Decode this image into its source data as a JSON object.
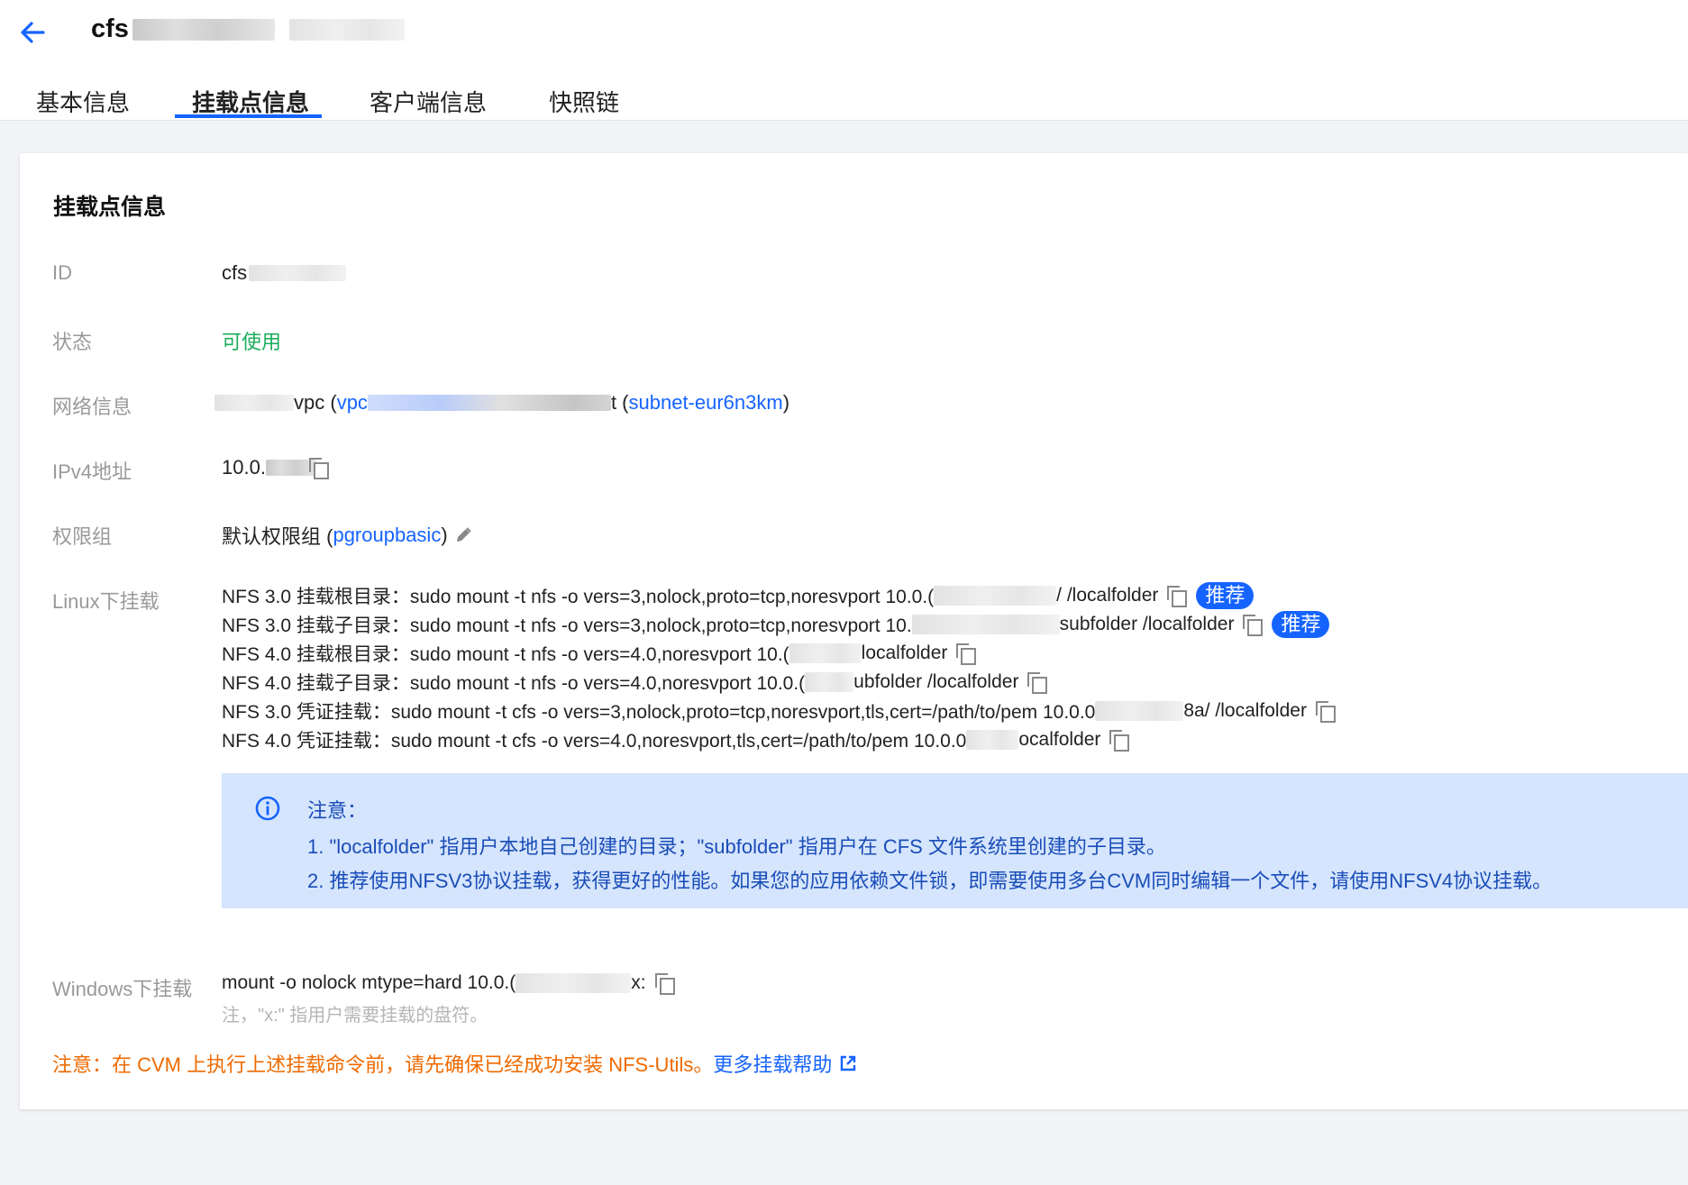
{
  "header": {
    "back_icon": "arrow-left-icon",
    "title_prefix": "cfs"
  },
  "tabs": [
    {
      "label": "基本信息"
    },
    {
      "label": "挂载点信息"
    },
    {
      "label": "客户端信息"
    },
    {
      "label": "快照链"
    }
  ],
  "card": {
    "title": "挂载点信息",
    "id": {
      "label": "ID",
      "value": "cfs"
    },
    "status": {
      "label": "状态",
      "value": "可使用",
      "color": "#1aad5a"
    },
    "network": {
      "label": "网络信息",
      "vpc_text": "vpc (",
      "vpc_link": "vpc",
      "subnet_prefix": "t (",
      "subnet_link": "subnet-eur6n3km",
      "subnet_suffix": ")"
    },
    "ipv4": {
      "label": "IPv4地址",
      "value": "10.0."
    },
    "perm": {
      "label": "权限组",
      "value": "默认权限组 (",
      "link": "pgroupbasic",
      "suffix": ")"
    },
    "linux": {
      "label": "Linux下挂载",
      "lines": [
        {
          "prefix": "NFS 3.0 挂载根目录：sudo mount -t nfs -o vers=3,nolock,proto=tcp,noresvport 10.0.(",
          "suffix": "/ /localfolder",
          "tag": "推荐"
        },
        {
          "prefix": "NFS 3.0 挂载子目录：sudo mount -t nfs -o vers=3,nolock,proto=tcp,noresvport 10.",
          "suffix": "subfolder /localfolder",
          "tag": "推荐"
        },
        {
          "prefix": "NFS 4.0 挂载根目录：sudo mount -t nfs -o vers=4.0,noresvport 10.(",
          "suffix": "localfolder",
          "tag": ""
        },
        {
          "prefix": "NFS 4.0 挂载子目录：sudo mount -t nfs -o vers=4.0,noresvport 10.0.(",
          "suffix": "ubfolder /localfolder",
          "tag": ""
        },
        {
          "prefix": "NFS 3.0 凭证挂载：sudo mount -t cfs -o vers=3,nolock,proto=tcp,noresvport,tls,cert=/path/to/pem 10.0.0",
          "suffix": "8a/ /localfolder",
          "tag": ""
        },
        {
          "prefix": "NFS 4.0 凭证挂载：sudo mount -t cfs -o vers=4.0,noresvport,tls,cert=/path/to/pem 10.0.0",
          "suffix": "ocalfolder",
          "tag": ""
        }
      ]
    },
    "notice": {
      "icon": "info-circle-icon",
      "title": "注意：",
      "line1": "1. \"localfolder\" 指用户本地自己创建的目录；\"subfolder\" 指用户在 CFS 文件系统里创建的子目录。",
      "line2": "2. 推荐使用NFSV3协议挂载，获得更好的性能。如果您的应用依赖文件锁，即需要使用多台CVM同时编辑一个文件，请使用NFSV4协议挂载。"
    },
    "windows": {
      "label": "Windows下挂载",
      "prefix": "mount -o nolock mtype=hard 10.0.(",
      "suffix": "x:",
      "hint": "注，\"x:\" 指用户需要挂载的盘符。"
    },
    "warning": {
      "text": "注意：在 CVM 上执行上述挂载命令前，请先确保已经成功安装 NFS-Utils。",
      "link": "更多挂载帮助",
      "icon": "external-link-icon"
    }
  },
  "colors": {
    "accent": "#1664ff",
    "notice_bg": "#d5e5fd",
    "warning": "#ef6a00"
  }
}
